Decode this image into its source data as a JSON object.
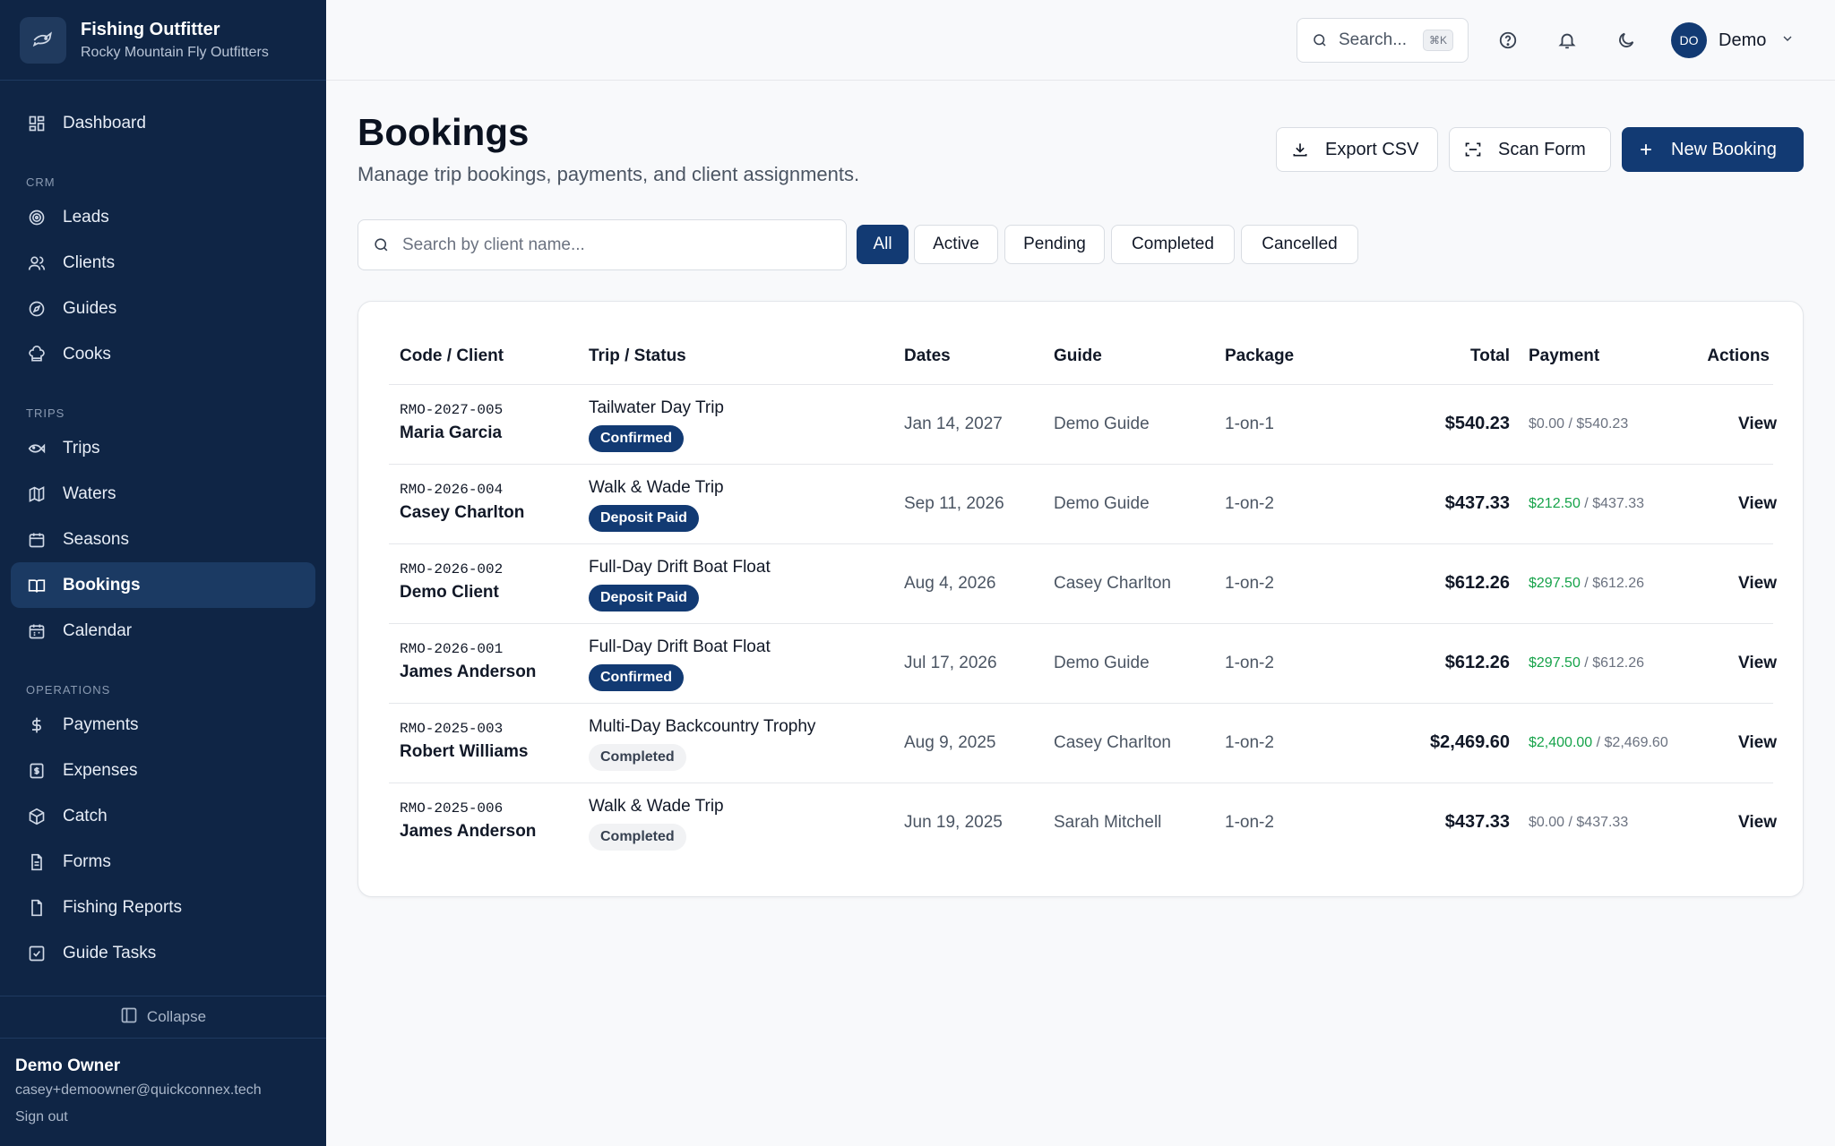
{
  "brand": {
    "title": "Fishing Outfitter",
    "subtitle": "Rocky Mountain Fly Outfitters"
  },
  "sidebar": {
    "dashboard": "Dashboard",
    "sections": {
      "crm": "CRM",
      "trips": "TRIPS",
      "operations": "OPERATIONS"
    },
    "items": {
      "leads": "Leads",
      "clients": "Clients",
      "guides": "Guides",
      "cooks": "Cooks",
      "trips": "Trips",
      "waters": "Waters",
      "seasons": "Seasons",
      "bookings": "Bookings",
      "calendar": "Calendar",
      "payments": "Payments",
      "expenses": "Expenses",
      "catch": "Catch",
      "forms": "Forms",
      "fishing_reports": "Fishing Reports",
      "guide_tasks": "Guide Tasks"
    },
    "collapse": "Collapse",
    "user": {
      "name": "Demo Owner",
      "email": "casey+demoowner@quickconnex.tech",
      "signout": "Sign out"
    }
  },
  "topbar": {
    "search_placeholder": "Search...",
    "shortcut": "⌘K",
    "avatar_initials": "DO",
    "user_name": "Demo"
  },
  "page": {
    "title": "Bookings",
    "subtitle": "Manage trip bookings, payments, and client assignments.",
    "export_label": "Export CSV",
    "scan_label": "Scan Form",
    "new_label": "New Booking"
  },
  "filters": {
    "search_placeholder": "Search by client name...",
    "chips": [
      "All",
      "Active",
      "Pending",
      "Completed",
      "Cancelled"
    ]
  },
  "table": {
    "headers": {
      "code_client": "Code / Client",
      "trip_status": "Trip / Status",
      "dates": "Dates",
      "guide": "Guide",
      "package": "Package",
      "total": "Total",
      "payment": "Payment",
      "actions": "Actions"
    },
    "rows": [
      {
        "code": "RMO-2027-005",
        "client": "Maria Garcia",
        "trip": "Tailwater Day Trip",
        "status": "Confirmed",
        "date": "Jan 14, 2027",
        "guide": "Demo Guide",
        "package": "1-on-1",
        "total": "$540.23",
        "paid": "$0.00",
        "due": "/ $540.23",
        "action": "View"
      },
      {
        "code": "RMO-2026-004",
        "client": "Casey Charlton",
        "trip": "Walk & Wade Trip",
        "status": "Deposit Paid",
        "date": "Sep 11, 2026",
        "guide": "Demo Guide",
        "package": "1-on-2",
        "total": "$437.33",
        "paid": "$212.50",
        "due": "/ $437.33",
        "action": "View"
      },
      {
        "code": "RMO-2026-002",
        "client": "Demo Client",
        "trip": "Full-Day Drift Boat Float",
        "status": "Deposit Paid",
        "date": "Aug 4, 2026",
        "guide": "Casey Charlton",
        "package": "1-on-2",
        "total": "$612.26",
        "paid": "$297.50",
        "due": "/ $612.26",
        "action": "View"
      },
      {
        "code": "RMO-2026-001",
        "client": "James Anderson",
        "trip": "Full-Day Drift Boat Float",
        "status": "Confirmed",
        "date": "Jul 17, 2026",
        "guide": "Demo Guide",
        "package": "1-on-2",
        "total": "$612.26",
        "paid": "$297.50",
        "due": "/ $612.26",
        "action": "View"
      },
      {
        "code": "RMO-2025-003",
        "client": "Robert Williams",
        "trip": "Multi-Day Backcountry Trophy",
        "status": "Completed",
        "date": "Aug 9, 2025",
        "guide": "Casey Charlton",
        "package": "1-on-2",
        "total": "$2,469.60",
        "paid": "$2,400.00",
        "due": "/ $2,469.60",
        "action": "View"
      },
      {
        "code": "RMO-2025-006",
        "client": "James Anderson",
        "trip": "Walk & Wade Trip",
        "status": "Completed",
        "date": "Jun 19, 2025",
        "guide": "Sarah Mitchell",
        "package": "1-on-2",
        "total": "$437.33",
        "paid": "$0.00",
        "due": "/ $437.33",
        "action": "View"
      }
    ]
  },
  "colors": {
    "navy": "#0f2545",
    "primary": "#123a73",
    "paid_green": "#16a34a"
  }
}
